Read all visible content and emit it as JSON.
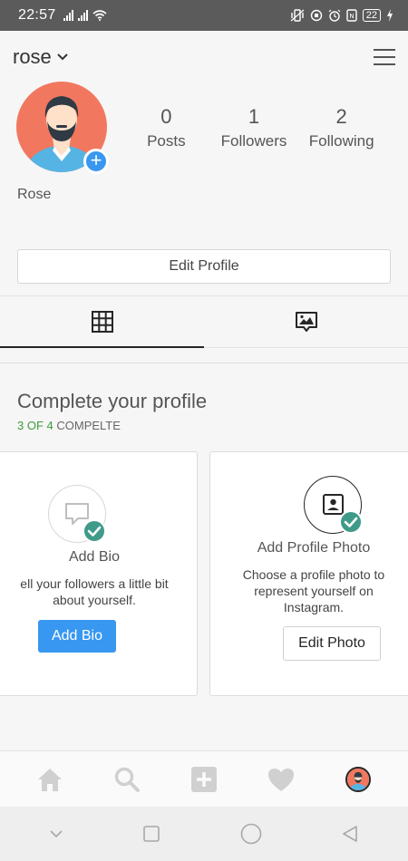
{
  "status_bar": {
    "time": "22:57",
    "battery": "22"
  },
  "header": {
    "username": "rose",
    "dropdown_icon": "chevron-down-icon",
    "menu_icon": "hamburger-menu-icon"
  },
  "profile": {
    "display_name": "Rose",
    "stats": [
      {
        "value": "0",
        "label": "Posts"
      },
      {
        "value": "1",
        "label": "Followers"
      },
      {
        "value": "2",
        "label": "Following"
      }
    ],
    "edit_button": "Edit Profile"
  },
  "tabs": [
    {
      "icon": "grid-icon",
      "active": true
    },
    {
      "icon": "tagged-photos-icon",
      "active": false
    }
  ],
  "complete_profile": {
    "title": "Complete your profile",
    "progress_count": "3 OF 4",
    "progress_label": "COMPELTE",
    "cards": [
      {
        "title": "Add Bio",
        "description": "ell your followers a little bit about yourself.",
        "button": "Add Bio",
        "icon": "speech-bubble-icon"
      },
      {
        "title": "Add Profile Photo",
        "description": "Choose a profile photo to represent yourself on Instagram.",
        "button": "Edit Photo",
        "icon": "profile-photo-icon"
      }
    ]
  },
  "bottom_nav": [
    "home-icon",
    "search-icon",
    "add-post-icon",
    "heart-icon",
    "profile-avatar"
  ],
  "colors": {
    "accent": "#3897f0",
    "progress_green": "#3d9b3d",
    "check_teal": "#3f9a89",
    "avatar_bg": "#f2775f"
  }
}
